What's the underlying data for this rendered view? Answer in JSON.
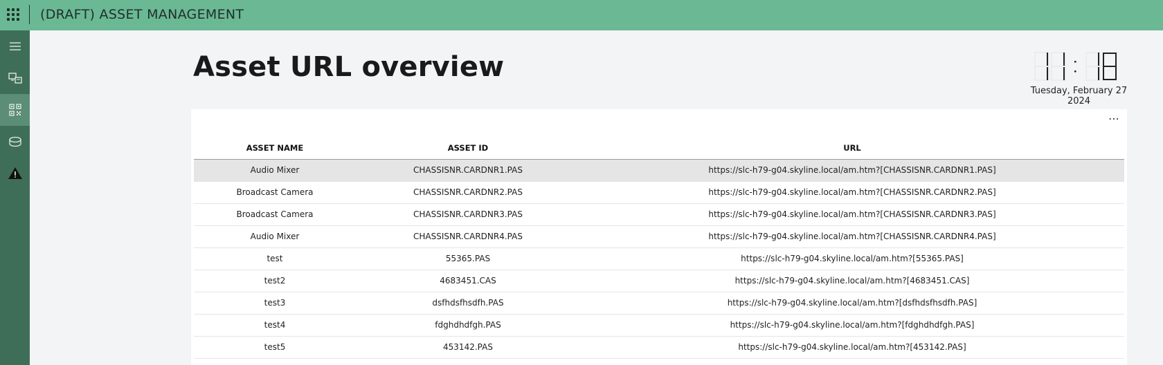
{
  "app": {
    "title": "(DRAFT) ASSET MANAGEMENT"
  },
  "sidebar": {
    "items": [
      {
        "name": "menu",
        "icon": "hamburger-icon"
      },
      {
        "name": "devices",
        "icon": "devices-icon"
      },
      {
        "name": "qr-code",
        "icon": "qr-code-icon",
        "active": true
      },
      {
        "name": "storage",
        "icon": "database-icon"
      },
      {
        "name": "alerts",
        "icon": "warning-icon"
      }
    ]
  },
  "page": {
    "title": "Asset URL overview"
  },
  "clock": {
    "hours": "11",
    "minutes": "18",
    "date": "Tuesday, February 27 2024"
  },
  "table": {
    "more_label": "⋯",
    "columns": [
      "ASSET NAME",
      "ASSET ID",
      "URL"
    ],
    "rows": [
      [
        "Audio Mixer",
        "CHASSISNR.CARDNR1.PAS",
        "https://slc-h79-g04.skyline.local/am.htm?[CHASSISNR.CARDNR1.PAS]"
      ],
      [
        "Broadcast Camera",
        "CHASSISNR.CARDNR2.PAS",
        "https://slc-h79-g04.skyline.local/am.htm?[CHASSISNR.CARDNR2.PAS]"
      ],
      [
        "Broadcast Camera",
        "CHASSISNR.CARDNR3.PAS",
        "https://slc-h79-g04.skyline.local/am.htm?[CHASSISNR.CARDNR3.PAS]"
      ],
      [
        "Audio Mixer",
        "CHASSISNR.CARDNR4.PAS",
        "https://slc-h79-g04.skyline.local/am.htm?[CHASSISNR.CARDNR4.PAS]"
      ],
      [
        "test",
        "55365.PAS",
        "https://slc-h79-g04.skyline.local/am.htm?[55365.PAS]"
      ],
      [
        "test2",
        "4683451.CAS",
        "https://slc-h79-g04.skyline.local/am.htm?[4683451.CAS]"
      ],
      [
        "test3",
        "dsfhdsfhsdfh.PAS",
        "https://slc-h79-g04.skyline.local/am.htm?[dsfhdsfhsdfh.PAS]"
      ],
      [
        "test4",
        "fdghdhdfgh.PAS",
        "https://slc-h79-g04.skyline.local/am.htm?[fdghdhdfgh.PAS]"
      ],
      [
        "test5",
        "453142.PAS",
        "https://slc-h79-g04.skyline.local/am.htm?[453142.PAS]"
      ]
    ],
    "selected_row": 0
  },
  "colors": {
    "topbar": "#6ab894",
    "sidebar": "#3f6e58",
    "sidebar_active": "#5c8d76",
    "page_background": "#f3f4f6",
    "selected_row": "#e5e5e5"
  }
}
